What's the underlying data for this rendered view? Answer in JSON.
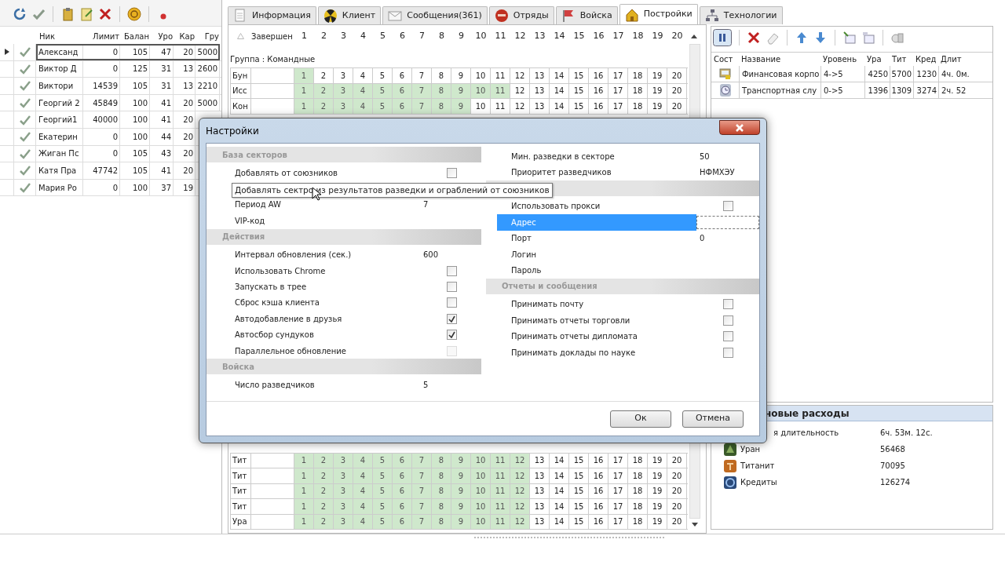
{
  "players": {
    "columns": [
      "Ник",
      "Лимит",
      "Балан",
      "Уро",
      "Кар",
      "Гру"
    ],
    "rows": [
      {
        "selected": true,
        "cells": [
          "Александ",
          "0",
          "105",
          "47",
          "20",
          "5000"
        ]
      },
      {
        "selected": false,
        "cells": [
          "Виктор Д",
          "0",
          "125",
          "31",
          "13",
          "2600"
        ]
      },
      {
        "selected": false,
        "cells": [
          "Виктори",
          "14539",
          "105",
          "31",
          "13",
          "2210"
        ]
      },
      {
        "selected": false,
        "cells": [
          "Георгий 2",
          "45849",
          "100",
          "41",
          "20",
          "5000"
        ]
      },
      {
        "selected": false,
        "cells": [
          "Георгий1",
          "40000",
          "100",
          "41",
          "20"
        ]
      },
      {
        "selected": false,
        "cells": [
          "Екатерин",
          "0",
          "100",
          "44",
          "20"
        ]
      },
      {
        "selected": false,
        "cells": [
          "Жиган Пс",
          "0",
          "105",
          "43",
          "20"
        ]
      },
      {
        "selected": false,
        "cells": [
          "Катя Пра",
          "47742",
          "105",
          "41",
          "20"
        ]
      },
      {
        "selected": false,
        "cells": [
          "Мария Ро",
          "0",
          "100",
          "37",
          "19"
        ]
      }
    ]
  },
  "tabs": [
    {
      "kind": "doc",
      "label": "Информация",
      "selected": false
    },
    {
      "kind": "radiation",
      "label": "Клиент",
      "selected": false
    },
    {
      "kind": "mail",
      "label": "Сообщения(361)",
      "selected": false
    },
    {
      "kind": "squad",
      "label": "Отряды",
      "selected": false
    },
    {
      "kind": "flag",
      "label": "Войска",
      "selected": false
    },
    {
      "kind": "building",
      "label": "Постройки",
      "selected": true
    },
    {
      "kind": "tree",
      "label": "Технологии",
      "selected": false
    }
  ],
  "grid": {
    "header": "Завершен",
    "numbers": [
      "1",
      "2",
      "3",
      "4",
      "5",
      "6",
      "7",
      "8",
      "9",
      "10",
      "11",
      "12",
      "13",
      "14",
      "15",
      "16",
      "17",
      "18",
      "19",
      "20"
    ],
    "group": "Группа : Командные",
    "top_rows": [
      {
        "name": "Бун",
        "cells": [
          {
            "text": "1",
            "done": true
          },
          {
            "text": "2",
            "done": false
          },
          {
            "text": "3",
            "done": false
          },
          {
            "text": "4",
            "done": false
          },
          {
            "text": "5",
            "done": false
          },
          {
            "text": "6",
            "done": false
          },
          {
            "text": "7",
            "done": false
          },
          {
            "text": "8",
            "done": false
          },
          {
            "text": "9",
            "done": false
          },
          {
            "text": "10",
            "done": false
          },
          {
            "text": "11",
            "done": false
          },
          {
            "text": "12",
            "done": false
          },
          {
            "text": "13",
            "done": false
          },
          {
            "text": "14",
            "done": false
          },
          {
            "text": "15",
            "done": false
          },
          {
            "text": "16",
            "done": false
          },
          {
            "text": "17",
            "done": false
          },
          {
            "text": "18",
            "done": false
          },
          {
            "text": "19",
            "done": false
          },
          {
            "text": "20",
            "done": false
          }
        ]
      },
      {
        "name": "Исс",
        "cells": [
          {
            "text": "1",
            "done": true
          },
          {
            "text": "2",
            "done": true
          },
          {
            "text": "3",
            "done": true
          },
          {
            "text": "4",
            "done": true
          },
          {
            "text": "5",
            "done": true
          },
          {
            "text": "6",
            "done": true
          },
          {
            "text": "7",
            "done": true
          },
          {
            "text": "8",
            "done": true
          },
          {
            "text": "9",
            "done": true
          },
          {
            "text": "10",
            "done": true
          },
          {
            "text": "11",
            "done": true
          },
          {
            "text": "12",
            "done": false
          },
          {
            "text": "13",
            "done": false
          },
          {
            "text": "14",
            "done": false
          },
          {
            "text": "15",
            "done": false
          },
          {
            "text": "16",
            "done": false
          },
          {
            "text": "17",
            "done": false
          },
          {
            "text": "18",
            "done": false
          },
          {
            "text": "19",
            "done": false
          },
          {
            "text": "20",
            "done": false
          }
        ]
      },
      {
        "name": "Кон",
        "cells": [
          {
            "text": "1",
            "done": true
          },
          {
            "text": "2",
            "done": true
          },
          {
            "text": "3",
            "done": true
          },
          {
            "text": "4",
            "done": true
          },
          {
            "text": "5",
            "done": true
          },
          {
            "text": "6",
            "done": true
          },
          {
            "text": "7",
            "done": true
          },
          {
            "text": "8",
            "done": true
          },
          {
            "text": "9",
            "done": true
          },
          {
            "text": "10",
            "done": false
          },
          {
            "text": "11",
            "done": false
          },
          {
            "text": "12",
            "done": false
          },
          {
            "text": "13",
            "done": false
          },
          {
            "text": "14",
            "done": false
          },
          {
            "text": "15",
            "done": false
          },
          {
            "text": "16",
            "done": false
          },
          {
            "text": "17",
            "done": false
          },
          {
            "text": "18",
            "done": false
          },
          {
            "text": "19",
            "done": false
          },
          {
            "text": "20",
            "done": false
          }
        ]
      }
    ],
    "bottom_rows": [
      {
        "name": "Тит",
        "cells": [
          {
            "text": "1",
            "done": true
          },
          {
            "text": "2",
            "done": true
          },
          {
            "text": "3",
            "done": true
          },
          {
            "text": "4",
            "done": true
          },
          {
            "text": "5",
            "done": true
          },
          {
            "text": "6",
            "done": true
          },
          {
            "text": "7",
            "done": true
          },
          {
            "text": "8",
            "done": true
          },
          {
            "text": "9",
            "done": true
          },
          {
            "text": "10",
            "done": true
          },
          {
            "text": "11",
            "done": true
          },
          {
            "text": "12",
            "done": true
          },
          {
            "text": "13",
            "done": false
          },
          {
            "text": "14",
            "done": false
          },
          {
            "text": "15",
            "done": false
          },
          {
            "text": "16",
            "done": false
          },
          {
            "text": "17",
            "done": false
          },
          {
            "text": "18",
            "done": false
          },
          {
            "text": "19",
            "done": false
          },
          {
            "text": "20",
            "done": false
          }
        ]
      },
      {
        "name": "Тит",
        "cells": [
          {
            "text": "1",
            "done": true
          },
          {
            "text": "2",
            "done": true
          },
          {
            "text": "3",
            "done": true
          },
          {
            "text": "4",
            "done": true
          },
          {
            "text": "5",
            "done": true
          },
          {
            "text": "6",
            "done": true
          },
          {
            "text": "7",
            "done": true
          },
          {
            "text": "8",
            "done": true
          },
          {
            "text": "9",
            "done": true
          },
          {
            "text": "10",
            "done": true
          },
          {
            "text": "11",
            "done": true
          },
          {
            "text": "12",
            "done": true
          },
          {
            "text": "13",
            "done": false
          },
          {
            "text": "14",
            "done": false
          },
          {
            "text": "15",
            "done": false
          },
          {
            "text": "16",
            "done": false
          },
          {
            "text": "17",
            "done": false
          },
          {
            "text": "18",
            "done": false
          },
          {
            "text": "19",
            "done": false
          },
          {
            "text": "20",
            "done": false
          }
        ]
      },
      {
        "name": "Тит",
        "cells": [
          {
            "text": "1",
            "done": true
          },
          {
            "text": "2",
            "done": true
          },
          {
            "text": "3",
            "done": true
          },
          {
            "text": "4",
            "done": true
          },
          {
            "text": "5",
            "done": true
          },
          {
            "text": "6",
            "done": true
          },
          {
            "text": "7",
            "done": true
          },
          {
            "text": "8",
            "done": true
          },
          {
            "text": "9",
            "done": true
          },
          {
            "text": "10",
            "done": true
          },
          {
            "text": "11",
            "done": true
          },
          {
            "text": "12",
            "done": true
          },
          {
            "text": "13",
            "done": false
          },
          {
            "text": "14",
            "done": false
          },
          {
            "text": "15",
            "done": false
          },
          {
            "text": "16",
            "done": false
          },
          {
            "text": "17",
            "done": false
          },
          {
            "text": "18",
            "done": false
          },
          {
            "text": "19",
            "done": false
          },
          {
            "text": "20",
            "done": false
          }
        ]
      },
      {
        "name": "Тит",
        "cells": [
          {
            "text": "1",
            "done": true
          },
          {
            "text": "2",
            "done": true
          },
          {
            "text": "3",
            "done": true
          },
          {
            "text": "4",
            "done": true
          },
          {
            "text": "5",
            "done": true
          },
          {
            "text": "6",
            "done": true
          },
          {
            "text": "7",
            "done": true
          },
          {
            "text": "8",
            "done": true
          },
          {
            "text": "9",
            "done": true
          },
          {
            "text": "10",
            "done": true
          },
          {
            "text": "11",
            "done": true
          },
          {
            "text": "12",
            "done": true
          },
          {
            "text": "13",
            "done": false
          },
          {
            "text": "14",
            "done": false
          },
          {
            "text": "15",
            "done": false
          },
          {
            "text": "16",
            "done": false
          },
          {
            "text": "17",
            "done": false
          },
          {
            "text": "18",
            "done": false
          },
          {
            "text": "19",
            "done": false
          },
          {
            "text": "20",
            "done": false
          }
        ]
      },
      {
        "name": "Ура",
        "cells": [
          {
            "text": "1",
            "done": true
          },
          {
            "text": "2",
            "done": true
          },
          {
            "text": "3",
            "done": true
          },
          {
            "text": "4",
            "done": true
          },
          {
            "text": "5",
            "done": true
          },
          {
            "text": "6",
            "done": true
          },
          {
            "text": "7",
            "done": true
          },
          {
            "text": "8",
            "done": true
          },
          {
            "text": "9",
            "done": true
          },
          {
            "text": "10",
            "done": true
          },
          {
            "text": "11",
            "done": true
          },
          {
            "text": "12",
            "done": true
          },
          {
            "text": "13",
            "done": false
          },
          {
            "text": "14",
            "done": false
          },
          {
            "text": "15",
            "done": false
          },
          {
            "text": "16",
            "done": false
          },
          {
            "text": "17",
            "done": false
          },
          {
            "text": "18",
            "done": false
          },
          {
            "text": "19",
            "done": false
          },
          {
            "text": "20",
            "done": false
          }
        ]
      }
    ]
  },
  "queue": {
    "state_header": "Сост",
    "columns": [
      "Название",
      "Уровень",
      "Ура",
      "Тит",
      "Кред",
      "Длит"
    ],
    "rows": [
      {
        "kind": "building",
        "cells": [
          "Финансовая корпо",
          "4->5",
          "4250",
          "5700",
          "1230",
          "4ч. 0м."
        ]
      },
      {
        "kind": "clock",
        "cells": [
          "Транспортная слу",
          "0->5",
          "1396",
          "1309",
          "3274",
          "2ч. 52"
        ]
      }
    ]
  },
  "expenses": {
    "title": "новые расходы",
    "rows": [
      {
        "kind": "time",
        "label": "я длительность",
        "value": "6ч. 53м. 12с."
      },
      {
        "kind": "uranium",
        "label": "Уран",
        "value": "56468"
      },
      {
        "kind": "titanite",
        "label": "Титанит",
        "value": "70095"
      },
      {
        "kind": "credits",
        "label": "Кредиты",
        "value": "126274"
      }
    ]
  },
  "dialog": {
    "title": "Настройки",
    "left": [
      {
        "header": true,
        "title": "База секторов",
        "rows": [
          {
            "kind": "check",
            "label": "Добавлять от союзников",
            "checked": false,
            "disabled": false,
            "selected": false
          },
          {
            "kind": "covered"
          },
          {
            "kind": "value",
            "label": "Период AW",
            "value": "7",
            "selected": false
          },
          {
            "kind": "text",
            "label": "VIP-код",
            "selected": false
          }
        ]
      },
      {
        "header": true,
        "title": "Действия",
        "rows": [
          {
            "kind": "value",
            "label": "Интервал обновления (сек.)",
            "value": "600",
            "selected": false
          },
          {
            "kind": "check",
            "label": "Использовать Chrome",
            "checked": false,
            "disabled": false,
            "selected": false
          },
          {
            "kind": "check",
            "label": "Запускать в трее",
            "checked": false,
            "disabled": false,
            "selected": false
          },
          {
            "kind": "check",
            "label": "Сброс кэша клиента",
            "checked": false,
            "disabled": false,
            "selected": false
          },
          {
            "kind": "check",
            "label": "Автодобавление в друзья",
            "checked": true,
            "disabled": false,
            "selected": false
          },
          {
            "kind": "check",
            "label": "Автосбор сундуков",
            "checked": true,
            "disabled": false,
            "selected": false
          },
          {
            "kind": "check",
            "label": "Параллельное обновление",
            "checked": false,
            "disabled": true,
            "selected": false
          }
        ]
      },
      {
        "header": true,
        "title": "Войска",
        "rows": [
          {
            "kind": "value",
            "label": "Число разведчиков",
            "value": "5",
            "selected": false
          }
        ]
      }
    ],
    "right": [
      {
        "header": false,
        "rows": [
          {
            "kind": "value",
            "label": "Мин. разведки в секторе",
            "value": "50",
            "selected": false
          },
          {
            "kind": "value",
            "label": "Приоритет разведчиков",
            "value": "НФМХЭУ",
            "selected": false
          }
        ]
      },
      {
        "header": true,
        "rows": [
          {
            "kind": "check",
            "label": "Использовать прокси",
            "checked": false,
            "disabled": false,
            "selected": false
          },
          {
            "kind": "field",
            "label": "Адрес",
            "selected": true
          },
          {
            "kind": "value",
            "label": "Порт",
            "value": "0",
            "selected": false
          },
          {
            "kind": "text",
            "label": "Логин",
            "selected": false
          },
          {
            "kind": "text",
            "label": "Пароль",
            "selected": false
          }
        ]
      },
      {
        "header": true,
        "title": "Отчеты и сообщения",
        "rows": [
          {
            "kind": "check",
            "label": "Принимать почту",
            "checked": false,
            "disabled": false,
            "selected": false
          },
          {
            "kind": "check",
            "label": "Принимать отчеты торговли",
            "checked": false,
            "disabled": false,
            "selected": false
          },
          {
            "kind": "check",
            "label": "Принимать отчеты дипломата",
            "checked": false,
            "disabled": false,
            "selected": false
          },
          {
            "kind": "check",
            "label": "Принимать доклады по науке",
            "checked": false,
            "disabled": false,
            "selected": false
          }
        ]
      }
    ],
    "buttons": [
      "Ок",
      "Отмена"
    ],
    "tooltip": "Добавлять сектро из результатов разведки и ограблений от союзников"
  }
}
